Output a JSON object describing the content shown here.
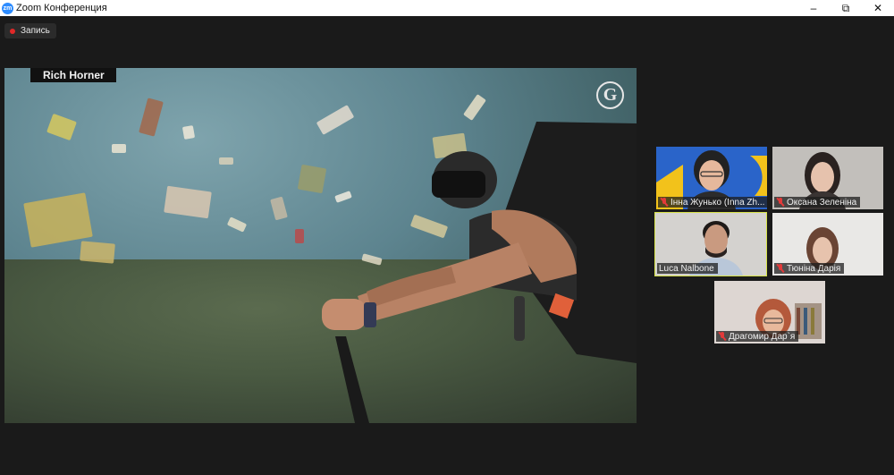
{
  "window": {
    "icon_text": "zm",
    "title": "Zoom Конференция",
    "controls": {
      "minimize": "–",
      "restore": "⧉",
      "close": "✕"
    }
  },
  "recording": {
    "label": "Запись",
    "color": "#e02828"
  },
  "screen_share": {
    "presenter_label": "Rich Horner",
    "brand_logo": "G"
  },
  "participants": [
    {
      "name": "Інна Жунько (Inna Zh...",
      "muted": true,
      "active": false
    },
    {
      "name": "Оксана Зеленіна",
      "muted": true,
      "active": false
    },
    {
      "name": "Luca Nalbone",
      "muted": false,
      "active": true
    },
    {
      "name": "Тюніна Дарія",
      "muted": true,
      "active": false
    },
    {
      "name": "Драгомир Дар`я",
      "muted": true,
      "active": false
    }
  ],
  "colors": {
    "active_speaker_border": "#d7e24a",
    "muted_icon": "#e23a3a",
    "background": "#1a1a1a"
  }
}
